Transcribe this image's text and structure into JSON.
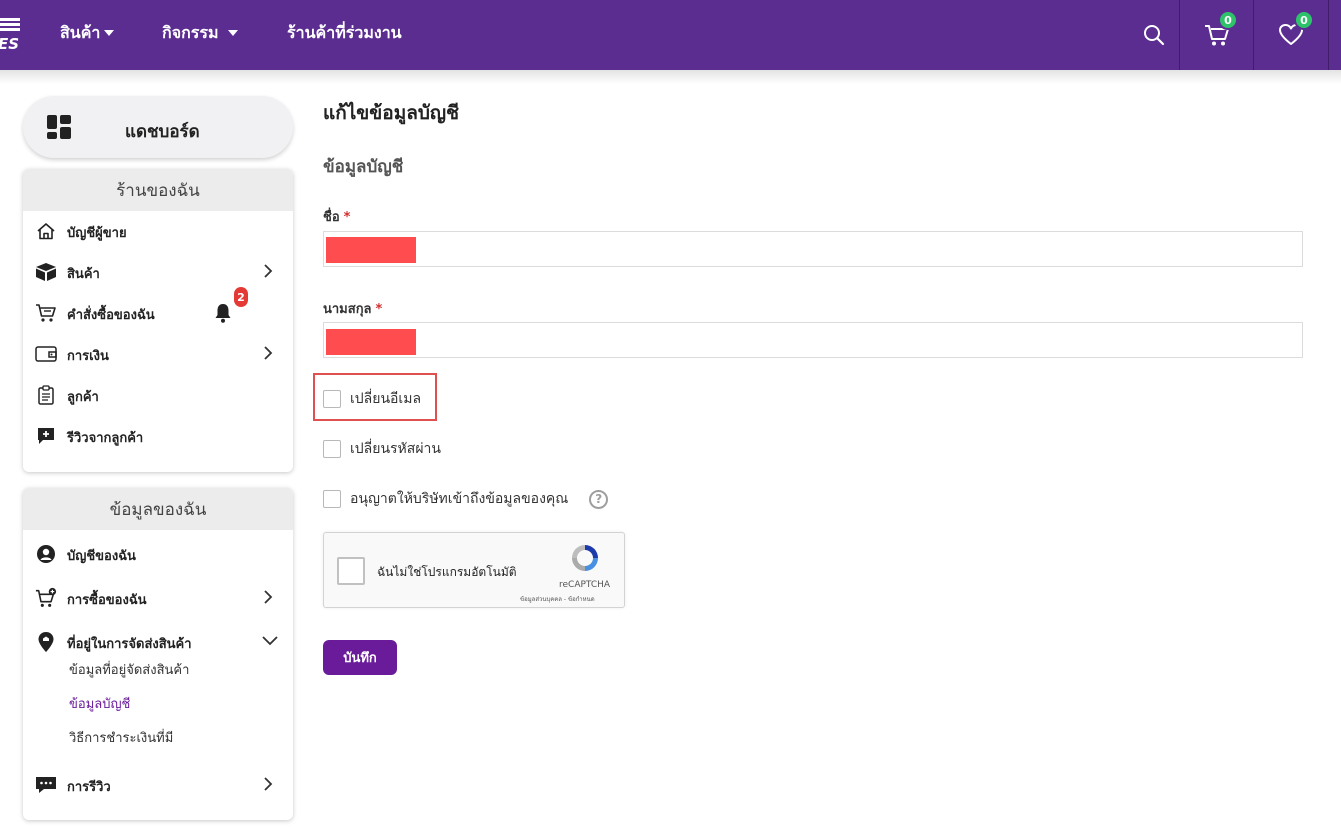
{
  "header": {
    "logo_text": "ES",
    "nav": [
      {
        "label": "สินค้า"
      },
      {
        "label": "กิจกรรม"
      },
      {
        "label": "ร้านค้าที่ร่วมงาน"
      }
    ],
    "cart_count": "0",
    "wishlist_count": "0",
    "colors": {
      "bar": "#5c2d91",
      "badge": "#2ec36b"
    }
  },
  "sidebar": {
    "dashboard_label": "แดชบอร์ด",
    "shop_panel": {
      "title": "ร้านของฉัน",
      "items": [
        {
          "label": "บัญชีผู้ขาย",
          "icon": "home-icon"
        },
        {
          "label": "สินค้า",
          "icon": "box-icon"
        },
        {
          "label": "คำสั่งซื้อของฉัน",
          "icon": "cart-icon",
          "notifications": "2"
        },
        {
          "label": "การเงิน",
          "icon": "wallet-icon"
        },
        {
          "label": "ลูกค้า",
          "icon": "clipboard-icon"
        },
        {
          "label": "รีวิวจากลูกค้า",
          "icon": "review-icon"
        }
      ]
    },
    "info_panel": {
      "title": "ข้อมูลของฉัน",
      "items": [
        {
          "label": "บัญชีของฉัน",
          "icon": "user-icon"
        },
        {
          "label": "การซื้อของฉัน",
          "icon": "cart-plus-icon"
        },
        {
          "label": "ที่อยู่ในการจัดส่งสินค้า",
          "icon": "location-icon"
        },
        {
          "label": "การรีวิว",
          "icon": "chat-icon"
        }
      ],
      "subitems": [
        {
          "label": "ข้อมูลที่อยู่จัดส่งสินค้า"
        },
        {
          "label": "ข้อมูลบัญชี",
          "active": true
        },
        {
          "label": "วิธีการชำระเงินที่มี"
        }
      ]
    }
  },
  "main": {
    "title": "แก้ไขข้อมูลบัญชี",
    "section_title": "ข้อมูลบัญชี",
    "first_name": {
      "label": "ชื่อ",
      "required_mark": "*",
      "value": ""
    },
    "last_name": {
      "label": "นามสกุล",
      "required_mark": "*",
      "value": ""
    },
    "checkboxes": [
      {
        "label": "เปลี่ยนอีเมล",
        "checked": false
      },
      {
        "label": "เปลี่ยนรหัสผ่าน",
        "checked": false
      },
      {
        "label": "อนุญาตให้บริษัทเข้าถึงข้อมูลของคุณ",
        "checked": false
      }
    ],
    "help_symbol": "?",
    "captcha": {
      "text": "ฉันไม่ใช่โปรแกรมอัตโนมัติ",
      "brand": "reCAPTCHA",
      "terms": "ข้อมูลส่วนบุคคล - ข้อกำหนด"
    },
    "save_label": "บันทึก",
    "colors": {
      "accent": "#6a1b9a",
      "redaction": "#ff4d4f",
      "focus_outline": "#e05050"
    }
  }
}
